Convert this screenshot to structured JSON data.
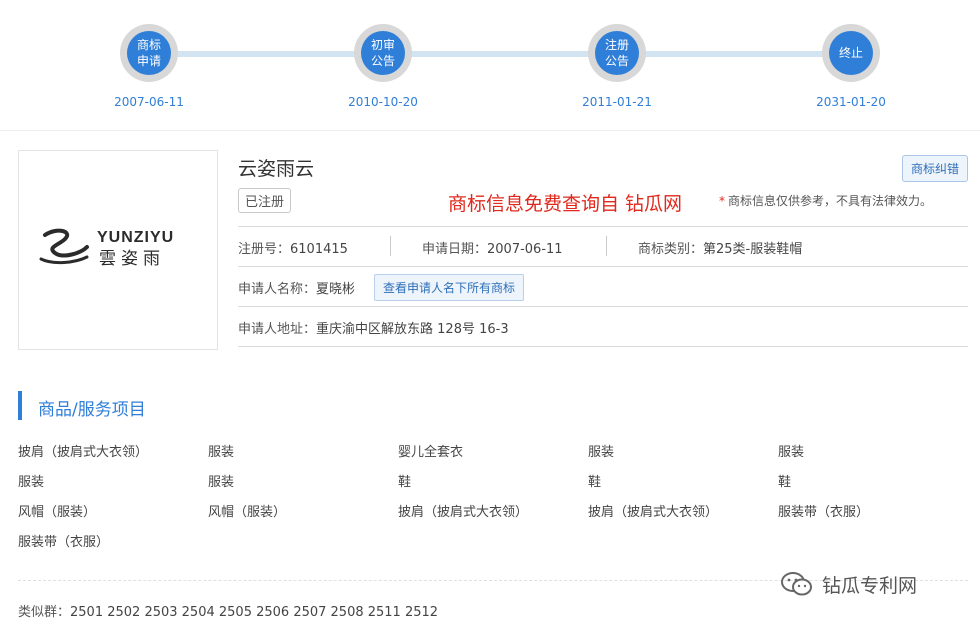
{
  "timeline": [
    {
      "label": "商标\n申请",
      "date": "2007-06-11"
    },
    {
      "label": "初审\n公告",
      "date": "2010-10-20"
    },
    {
      "label": "注册\n公告",
      "date": "2011-01-21"
    },
    {
      "label": "终止",
      "date": "2031-01-20"
    }
  ],
  "logo": {
    "text_en": "YUNZIYU",
    "text_cn": "雲姿雨"
  },
  "trademark": {
    "name": "云姿雨云",
    "status": "已注册",
    "fix_button": "商标纠错",
    "promo": "商标信息免费查询自 钻瓜网",
    "disclaimer_star": "*",
    "disclaimer": "商标信息仅供参考，不具有法律效力。",
    "reg_no_label": "注册号：",
    "reg_no": "6101415",
    "apply_date_label": "申请日期：",
    "apply_date": "2007-06-11",
    "class_label": "商标类别：",
    "class_value": "第25类-服装鞋帽",
    "applicant_label": "申请人名称：",
    "applicant": "夏晓彬",
    "all_tm_button": "查看申请人名下所有商标",
    "address_label": "申请人地址：",
    "address": "重庆渝中区解放东路 128号 16-3"
  },
  "goods": {
    "title": "商品/服务项目",
    "rows": [
      [
        "披肩（披肩式大衣领）",
        "服装",
        "婴儿全套衣",
        "服装",
        "服装"
      ],
      [
        "服装",
        "服装",
        "鞋",
        "鞋",
        "鞋"
      ],
      [
        "风帽（服装）",
        "风帽（服装）",
        "披肩（披肩式大衣领）",
        "披肩（披肩式大衣领）",
        "服装带（衣服）"
      ],
      [
        "服装带（衣服）",
        "",
        "",
        "",
        ""
      ]
    ]
  },
  "similar": {
    "label": "类似群：",
    "value": "2501 2502 2503 2504 2505 2506 2507 2508 2511 2512"
  },
  "watermark": {
    "text": "钻瓜专利网"
  },
  "colors": {
    "accent": "#2f7ed8",
    "promo": "#e0281d"
  }
}
